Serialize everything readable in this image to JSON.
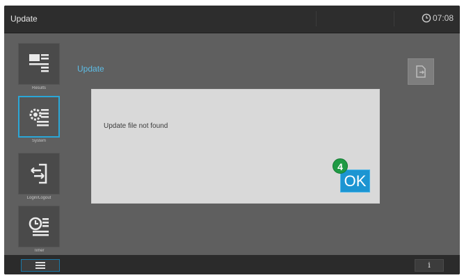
{
  "header": {
    "title": "Update",
    "time": "07:08"
  },
  "sidebar": {
    "items": [
      {
        "label": "Results",
        "icon": "results-list-icon",
        "active": false
      },
      {
        "label": "System",
        "icon": "system-settings-icon",
        "active": true
      },
      {
        "label": "Login/Logout",
        "icon": "login-logout-icon",
        "active": false
      },
      {
        "label": "Timer",
        "icon": "timer-icon",
        "active": false
      }
    ]
  },
  "main": {
    "title": "Update",
    "doc_button_icon": "document-export-icon"
  },
  "dialog": {
    "message": "Update file not found",
    "ok_label": "OK"
  },
  "callout": {
    "number": "4",
    "color": "#1f9a44"
  },
  "footer": {
    "menu_icon": "hamburger-menu-icon",
    "info_label": "i"
  },
  "colors": {
    "accent": "#1c95d2",
    "title_text": "#5ebde6"
  }
}
